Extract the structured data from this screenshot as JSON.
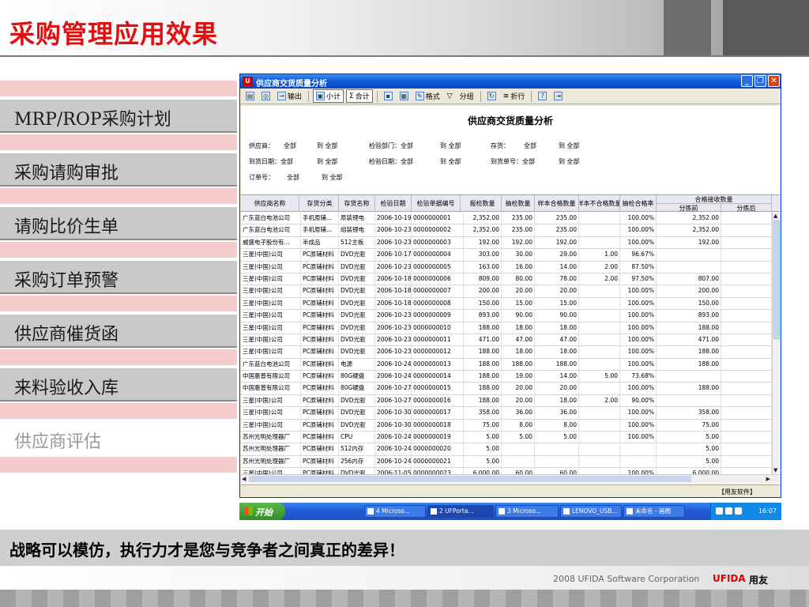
{
  "slide": {
    "title": "采购管理应用效果",
    "tagline": "战略可以模仿，执行力才是您与竞争者之间真正的差异！",
    "copyright": "2008 UFIDA Software Corporation",
    "brand": "UFIDA",
    "brand_cn": "用友"
  },
  "menu": [
    {
      "label": "MRP/ROP采购计划"
    },
    {
      "label": "采购请购审批"
    },
    {
      "label": "请购比价生单"
    },
    {
      "label": "采购订单预警"
    },
    {
      "label": "供应商催货函"
    },
    {
      "label": "来料验收入库"
    },
    {
      "label": "供应商评估"
    }
  ],
  "window": {
    "title": "供应商交货质量分析",
    "toolbar": {
      "output": "输出",
      "subtotal": "小计",
      "total": "合计",
      "format": "格式",
      "group": "分组",
      "fold": "折行"
    },
    "report_title": "供应商交货质量分析",
    "filters": [
      [
        "供应商：",
        "全部",
        "到 全部",
        "检验部门：全部",
        "到 全部",
        "存货：",
        "全部",
        "到 全部"
      ],
      [
        "到货日期：全部",
        "到 全部",
        "检验日期：全部",
        "到 全部",
        "到货单号：全部",
        "到 全部"
      ],
      [
        "订单号：",
        "全部",
        "到 全部"
      ]
    ],
    "columns": [
      "供应商名称",
      "存货分类",
      "存货名称",
      "检验日期",
      "检验单据编号",
      "报检数量",
      "抽检数量",
      "样本合格数量",
      "样本不合格数量",
      "抽检合格率"
    ],
    "group_header": "合格接收数量",
    "sub_columns": [
      "分拣前",
      "分拣后"
    ],
    "rows": [
      [
        "广东蓝白电池公司",
        "手机原辅...",
        "原装锂电",
        "2006-10-19",
        "0000000001",
        "2,352.00",
        "235.00",
        "235.00",
        "",
        "100.00%",
        "2,352.00",
        ""
      ],
      [
        "广东蓝白电池公司",
        "手机原辅...",
        "组装锂电",
        "2006-10-23",
        "0000000002",
        "2,352.00",
        "235.00",
        "235.00",
        "",
        "100.00%",
        "2,352.00",
        ""
      ],
      [
        "威盛电子股份有...",
        "半成品",
        "512主板",
        "2006-10-23",
        "0000000003",
        "192.00",
        "192.00",
        "192.00",
        "",
        "100.00%",
        "192.00",
        ""
      ],
      [
        "三星(中国)公司",
        "PC原辅材料",
        "DVD光驱",
        "2006-10-17",
        "0000000004",
        "303.00",
        "30.00",
        "29.00",
        "1.00",
        "96.67%",
        "",
        ""
      ],
      [
        "三星(中国)公司",
        "PC原辅材料",
        "DVD光驱",
        "2006-10-23",
        "0000000005",
        "163.00",
        "16.00",
        "14.00",
        "2.00",
        "87.50%",
        "",
        ""
      ],
      [
        "三星(中国)公司",
        "PC原辅材料",
        "DVD光驱",
        "2006-10-18",
        "0000000006",
        "809.00",
        "80.00",
        "78.00",
        "2.00",
        "97.50%",
        "807.00",
        ""
      ],
      [
        "三星(中国)公司",
        "PC原辅材料",
        "DVD光驱",
        "2006-10-18",
        "0000000007",
        "200.00",
        "20.00",
        "20.00",
        "",
        "100.00%",
        "200.00",
        ""
      ],
      [
        "三星(中国)公司",
        "PC原辅材料",
        "DVD光驱",
        "2006-10-18",
        "0000000008",
        "150.00",
        "15.00",
        "15.00",
        "",
        "100.00%",
        "150.00",
        ""
      ],
      [
        "三星(中国)公司",
        "PC原辅材料",
        "DVD光驱",
        "2006-10-23",
        "0000000009",
        "893.00",
        "90.00",
        "90.00",
        "",
        "100.00%",
        "893.00",
        ""
      ],
      [
        "三星(中国)公司",
        "PC原辅材料",
        "DVD光驱",
        "2006-10-23",
        "0000000010",
        "188.00",
        "18.00",
        "18.00",
        "",
        "100.00%",
        "188.00",
        ""
      ],
      [
        "三星(中国)公司",
        "PC原辅材料",
        "DVD光驱",
        "2006-10-23",
        "0000000011",
        "471.00",
        "47.00",
        "47.00",
        "",
        "100.00%",
        "471.00",
        ""
      ],
      [
        "三星(中国)公司",
        "PC原辅材料",
        "DVD光驱",
        "2006-10-23",
        "0000000012",
        "188.00",
        "18.00",
        "18.00",
        "",
        "100.00%",
        "188.00",
        ""
      ],
      [
        "广东蓝白电池公司",
        "PC原辅材料",
        "电源",
        "2006-10-24",
        "0000000013",
        "188.00",
        "188.00",
        "188.00",
        "",
        "100.00%",
        "188.00",
        ""
      ],
      [
        "中国惠普有限公司",
        "PC原辅材料",
        "80G硬盘",
        "2006-10-24",
        "0000000014",
        "188.00",
        "19.00",
        "14.00",
        "5.00",
        "73.68%",
        "",
        ""
      ],
      [
        "中国惠普有限公司",
        "PC原辅材料",
        "80G硬盘",
        "2006-10-27",
        "0000000015",
        "188.00",
        "20.00",
        "20.00",
        "",
        "100.00%",
        "188.00",
        ""
      ],
      [
        "三星(中国)公司",
        "PC原辅材料",
        "DVD光驱",
        "2006-10-27",
        "0000000016",
        "188.00",
        "20.00",
        "18.00",
        "2.00",
        "90.00%",
        "",
        ""
      ],
      [
        "三星(中国)公司",
        "PC原辅材料",
        "DVD光驱",
        "2006-10-30",
        "0000000017",
        "358.00",
        "36.00",
        "36.00",
        "",
        "100.00%",
        "358.00",
        ""
      ],
      [
        "三星(中国)公司",
        "PC原辅材料",
        "DVD光驱",
        "2006-10-30",
        "0000000018",
        "75.00",
        "8.00",
        "8.00",
        "",
        "100.00%",
        "75.00",
        ""
      ],
      [
        "苏州光明处理器厂",
        "PC原辅材料",
        "CPU",
        "2006-10-24",
        "0000000019",
        "5.00",
        "5.00",
        "5.00",
        "",
        "100.00%",
        "5.00",
        ""
      ],
      [
        "苏州光明处理器厂",
        "PC原辅材料",
        "512内存",
        "2006-10-24",
        "0000000020",
        "5.00",
        "",
        "",
        "",
        "",
        "5.00",
        ""
      ],
      [
        "苏州光明处理器厂",
        "PC原辅材料",
        "256内存",
        "2006-10-24",
        "0000000021",
        "5.00",
        "",
        "",
        "",
        "",
        "5.00",
        ""
      ],
      [
        "三星(中国)公司",
        "PC原辅材料",
        "DVD光驱",
        "2006-11-05",
        "0000000023",
        "6,000.00",
        "60.00",
        "60.00",
        "",
        "100.00%",
        "6,000.00",
        ""
      ]
    ],
    "status": "【用友软件】"
  },
  "taskbar": {
    "start": "开始",
    "tasks": [
      "4 Microso...",
      "2 UFPorta...",
      "3 Microso...",
      "LENOVO_USB...",
      "未命名 - 画图"
    ],
    "clock": "16:07"
  }
}
